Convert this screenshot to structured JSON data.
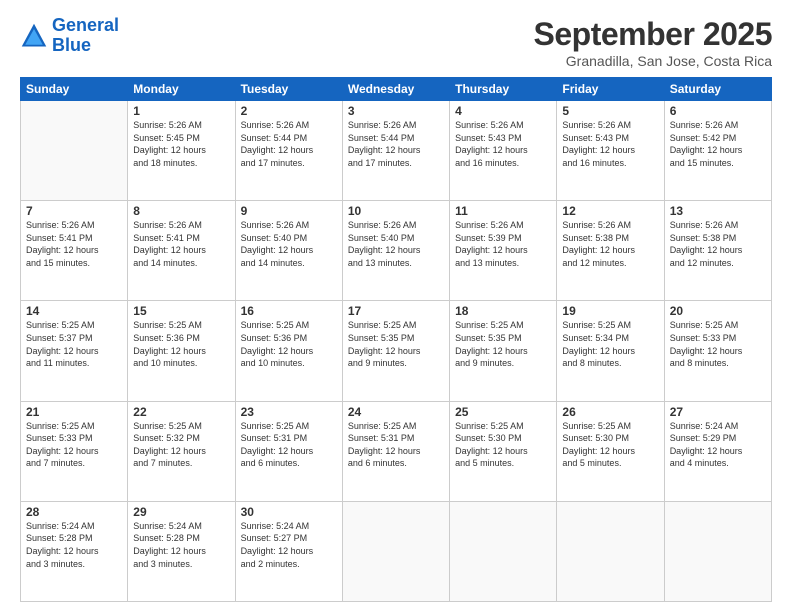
{
  "logo": {
    "line1": "General",
    "line2": "Blue"
  },
  "title": "September 2025",
  "subtitle": "Granadilla, San Jose, Costa Rica",
  "weekdays": [
    "Sunday",
    "Monday",
    "Tuesday",
    "Wednesday",
    "Thursday",
    "Friday",
    "Saturday"
  ],
  "weeks": [
    [
      {
        "day": "",
        "info": ""
      },
      {
        "day": "1",
        "info": "Sunrise: 5:26 AM\nSunset: 5:45 PM\nDaylight: 12 hours\nand 18 minutes."
      },
      {
        "day": "2",
        "info": "Sunrise: 5:26 AM\nSunset: 5:44 PM\nDaylight: 12 hours\nand 17 minutes."
      },
      {
        "day": "3",
        "info": "Sunrise: 5:26 AM\nSunset: 5:44 PM\nDaylight: 12 hours\nand 17 minutes."
      },
      {
        "day": "4",
        "info": "Sunrise: 5:26 AM\nSunset: 5:43 PM\nDaylight: 12 hours\nand 16 minutes."
      },
      {
        "day": "5",
        "info": "Sunrise: 5:26 AM\nSunset: 5:43 PM\nDaylight: 12 hours\nand 16 minutes."
      },
      {
        "day": "6",
        "info": "Sunrise: 5:26 AM\nSunset: 5:42 PM\nDaylight: 12 hours\nand 15 minutes."
      }
    ],
    [
      {
        "day": "7",
        "info": "Sunrise: 5:26 AM\nSunset: 5:41 PM\nDaylight: 12 hours\nand 15 minutes."
      },
      {
        "day": "8",
        "info": "Sunrise: 5:26 AM\nSunset: 5:41 PM\nDaylight: 12 hours\nand 14 minutes."
      },
      {
        "day": "9",
        "info": "Sunrise: 5:26 AM\nSunset: 5:40 PM\nDaylight: 12 hours\nand 14 minutes."
      },
      {
        "day": "10",
        "info": "Sunrise: 5:26 AM\nSunset: 5:40 PM\nDaylight: 12 hours\nand 13 minutes."
      },
      {
        "day": "11",
        "info": "Sunrise: 5:26 AM\nSunset: 5:39 PM\nDaylight: 12 hours\nand 13 minutes."
      },
      {
        "day": "12",
        "info": "Sunrise: 5:26 AM\nSunset: 5:38 PM\nDaylight: 12 hours\nand 12 minutes."
      },
      {
        "day": "13",
        "info": "Sunrise: 5:26 AM\nSunset: 5:38 PM\nDaylight: 12 hours\nand 12 minutes."
      }
    ],
    [
      {
        "day": "14",
        "info": "Sunrise: 5:25 AM\nSunset: 5:37 PM\nDaylight: 12 hours\nand 11 minutes."
      },
      {
        "day": "15",
        "info": "Sunrise: 5:25 AM\nSunset: 5:36 PM\nDaylight: 12 hours\nand 10 minutes."
      },
      {
        "day": "16",
        "info": "Sunrise: 5:25 AM\nSunset: 5:36 PM\nDaylight: 12 hours\nand 10 minutes."
      },
      {
        "day": "17",
        "info": "Sunrise: 5:25 AM\nSunset: 5:35 PM\nDaylight: 12 hours\nand 9 minutes."
      },
      {
        "day": "18",
        "info": "Sunrise: 5:25 AM\nSunset: 5:35 PM\nDaylight: 12 hours\nand 9 minutes."
      },
      {
        "day": "19",
        "info": "Sunrise: 5:25 AM\nSunset: 5:34 PM\nDaylight: 12 hours\nand 8 minutes."
      },
      {
        "day": "20",
        "info": "Sunrise: 5:25 AM\nSunset: 5:33 PM\nDaylight: 12 hours\nand 8 minutes."
      }
    ],
    [
      {
        "day": "21",
        "info": "Sunrise: 5:25 AM\nSunset: 5:33 PM\nDaylight: 12 hours\nand 7 minutes."
      },
      {
        "day": "22",
        "info": "Sunrise: 5:25 AM\nSunset: 5:32 PM\nDaylight: 12 hours\nand 7 minutes."
      },
      {
        "day": "23",
        "info": "Sunrise: 5:25 AM\nSunset: 5:31 PM\nDaylight: 12 hours\nand 6 minutes."
      },
      {
        "day": "24",
        "info": "Sunrise: 5:25 AM\nSunset: 5:31 PM\nDaylight: 12 hours\nand 6 minutes."
      },
      {
        "day": "25",
        "info": "Sunrise: 5:25 AM\nSunset: 5:30 PM\nDaylight: 12 hours\nand 5 minutes."
      },
      {
        "day": "26",
        "info": "Sunrise: 5:25 AM\nSunset: 5:30 PM\nDaylight: 12 hours\nand 5 minutes."
      },
      {
        "day": "27",
        "info": "Sunrise: 5:24 AM\nSunset: 5:29 PM\nDaylight: 12 hours\nand 4 minutes."
      }
    ],
    [
      {
        "day": "28",
        "info": "Sunrise: 5:24 AM\nSunset: 5:28 PM\nDaylight: 12 hours\nand 3 minutes."
      },
      {
        "day": "29",
        "info": "Sunrise: 5:24 AM\nSunset: 5:28 PM\nDaylight: 12 hours\nand 3 minutes."
      },
      {
        "day": "30",
        "info": "Sunrise: 5:24 AM\nSunset: 5:27 PM\nDaylight: 12 hours\nand 2 minutes."
      },
      {
        "day": "",
        "info": ""
      },
      {
        "day": "",
        "info": ""
      },
      {
        "day": "",
        "info": ""
      },
      {
        "day": "",
        "info": ""
      }
    ]
  ]
}
